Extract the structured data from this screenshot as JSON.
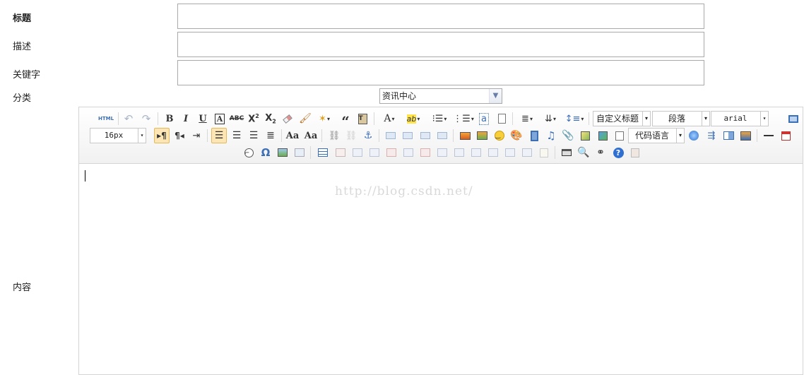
{
  "form": {
    "title_label": "标题",
    "desc_label": "描述",
    "keywords_label": "关键字",
    "category_label": "分类",
    "content_label": "内容",
    "category_value": "资讯中心"
  },
  "toolbar": {
    "custom_heading": "自定义标题",
    "paragraph": "段落",
    "font_family": "arial",
    "font_size": "16px",
    "code_language": "代码语言",
    "html_label": "HTML"
  },
  "editor": {
    "watermark": "http://blog.csdn.net/"
  },
  "colors": {
    "toolbar_bg": "#f1f1f1",
    "border": "#d4d4d4",
    "active_bg": "#fde6b4",
    "icon_blue": "#3d6fb6"
  }
}
